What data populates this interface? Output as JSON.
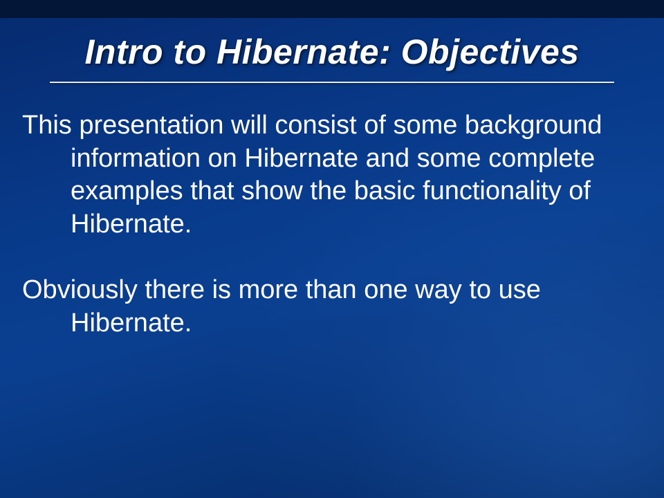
{
  "slide": {
    "title": "Intro to Hibernate: Objectives",
    "paragraphs": [
      "This presentation will consist of some background information on Hibernate and some complete examples that show the basic functionality of Hibernate.",
      "Obviously there is more than one way to use Hibernate."
    ]
  }
}
